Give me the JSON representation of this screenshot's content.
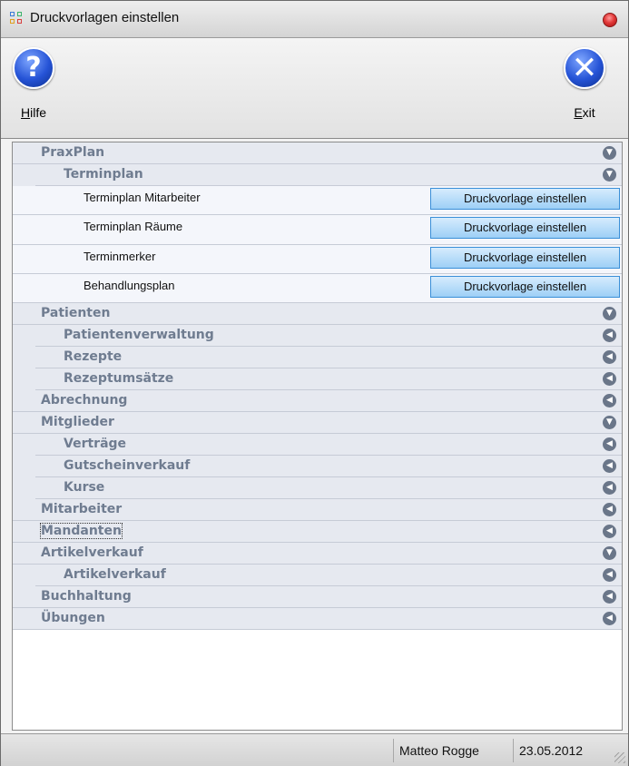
{
  "window": {
    "title": "Druckvorlagen einstellen"
  },
  "toolbar": {
    "help": {
      "label_prefix": "H",
      "label_rest": "ilfe",
      "icon": "question-mark-icon"
    },
    "exit": {
      "label_prefix": "E",
      "label_rest": "xit",
      "icon": "close-x-icon"
    }
  },
  "tree": {
    "praxplan": "PraxPlan",
    "terminplan": "Terminplan",
    "leaves": [
      {
        "label": "Terminplan Mitarbeiter",
        "button": "Druckvorlage einstellen"
      },
      {
        "label": "Terminplan Räume",
        "button": "Druckvorlage einstellen"
      },
      {
        "label": "Terminmerker",
        "button": "Druckvorlage einstellen"
      },
      {
        "label": "Behandlungsplan",
        "button": "Druckvorlage einstellen"
      }
    ],
    "patienten": "Patienten",
    "patientenverwaltung": "Patientenverwaltung",
    "rezepte": "Rezepte",
    "rezeptumsaetze": "Rezeptumsätze",
    "abrechnung": "Abrechnung",
    "mitglieder": "Mitglieder",
    "vertraege": "Verträge",
    "gutscheinverkauf": "Gutscheinverkauf",
    "kurse": "Kurse",
    "mitarbeiter": "Mitarbeiter",
    "mandanten": "Mandanten",
    "artikelverkauf": "Artikelverkauf",
    "artikelverkauf_sub": "Artikelverkauf",
    "buchhaltung": "Buchhaltung",
    "uebungen": "Übungen"
  },
  "statusbar": {
    "user": "Matteo Rogge",
    "date": "23.05.2012"
  },
  "colors": {
    "accent": "#2553d6",
    "group_bg": "#e6e9f0",
    "group_text": "#6f7c90",
    "button_border": "#3a8fd8"
  }
}
